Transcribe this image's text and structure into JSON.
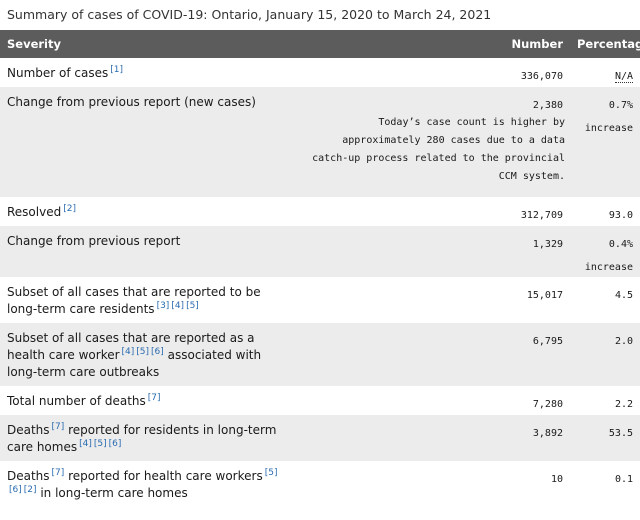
{
  "caption": "Summary of cases of COVID-19: Ontario, January 15, 2020 to March 24, 2021",
  "headers": {
    "severity": "Severity",
    "number": "Number",
    "percentage": "Percentage"
  },
  "rows": [
    {
      "label": "Number of cases",
      "refs": [
        "[1]"
      ],
      "number": "336,070",
      "pct": "N/A"
    },
    {
      "label": "Change from previous report (new cases)",
      "number": "2,380",
      "pct": "0.7%",
      "pct_sub": "increase",
      "note": "Today’s case count is higher by approximately 280 cases due to a data catch-up process related to the provincial CCM system."
    },
    {
      "label": "Resolved",
      "refs": [
        "[2]"
      ],
      "number": "312,709",
      "pct": "93.0"
    },
    {
      "label": "Change from previous report",
      "number": "1,329",
      "pct": "0.4%",
      "pct_sub": "increase"
    },
    {
      "label": "Subset of all cases that are reported to be long-term care residents",
      "refs": [
        "[3]",
        "[4]",
        "[5]"
      ],
      "number": "15,017",
      "pct": "4.5"
    },
    {
      "label_a": "Subset of all cases that are reported as a health care worker",
      "refs": [
        "[4]",
        "[5]",
        "[6]"
      ],
      "label_b": "associated with long-term care outbreaks",
      "number": "6,795",
      "pct": "2.0"
    },
    {
      "label": "Total number of deaths",
      "refs": [
        "[7]"
      ],
      "number": "7,280",
      "pct": "2.2"
    },
    {
      "label_a": "Deaths",
      "refs_a": [
        "[7]"
      ],
      "label_b": "reported for residents in long-term care homes",
      "refs_b": [
        "[4]",
        "[5]",
        "[6]"
      ],
      "number": "3,892",
      "pct": "53.5"
    },
    {
      "label_a": "Deaths",
      "refs_a": [
        "[7]"
      ],
      "label_b": "reported for health care workers",
      "refs_b": [
        "[5]",
        "[6]",
        "[2]"
      ],
      "label_c": "in long-term care homes",
      "number": "10",
      "pct": "0.1"
    }
  ]
}
